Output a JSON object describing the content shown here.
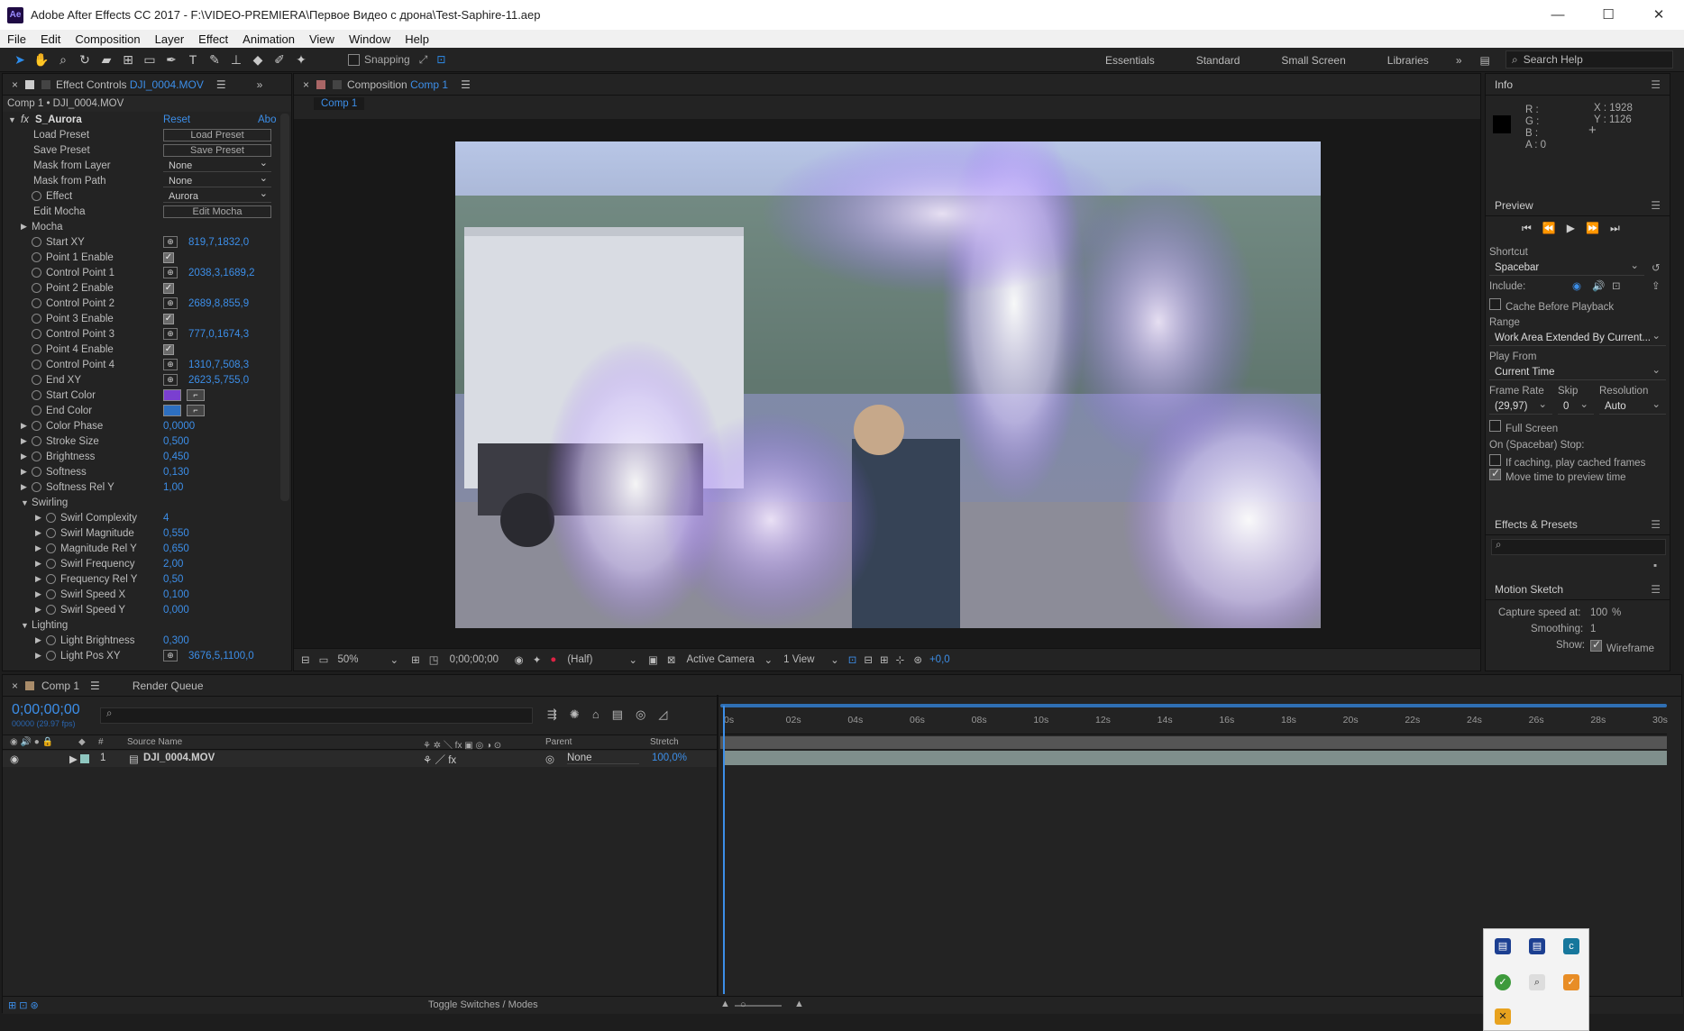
{
  "window": {
    "title": "Adobe After Effects CC 2017 - F:\\VIDEO-PREMIERA\\Первое Видео с дрона\\Test-Saphire-11.aep",
    "logo": "Ae"
  },
  "menu": [
    "File",
    "Edit",
    "Composition",
    "Layer",
    "Effect",
    "Animation",
    "View",
    "Window",
    "Help"
  ],
  "toolbar": {
    "snapping": "Snapping",
    "workspaces": [
      "Essentials",
      "Standard",
      "Small Screen",
      "Libraries"
    ],
    "search_placeholder": "Search Help"
  },
  "effect_controls": {
    "tab_label": "Effect Controls",
    "tab_file": "DJI_0004.MOV",
    "breadcrumb": "Comp 1 • DJI_0004.MOV",
    "effect_name": "S_Aurora",
    "reset": "Reset",
    "about": "Abo",
    "rows": [
      {
        "label": "Load Preset",
        "kind": "button",
        "value": "Load Preset"
      },
      {
        "label": "Save Preset",
        "kind": "button",
        "value": "Save Preset"
      },
      {
        "label": "Mask from Layer",
        "kind": "dropdown",
        "value": "None"
      },
      {
        "label": "Mask from Path",
        "kind": "dropdown",
        "value": "None"
      },
      {
        "label": "Effect",
        "kind": "dropdown",
        "value": "Aurora",
        "sw": true
      },
      {
        "label": "Edit Mocha",
        "kind": "button",
        "value": "Edit Mocha"
      },
      {
        "label": "Mocha",
        "kind": "group",
        "indent": 0
      },
      {
        "label": "Start XY",
        "kind": "xy",
        "value": "819,7,1832,0",
        "sw": true
      },
      {
        "label": "Point 1 Enable",
        "kind": "check",
        "sw": true
      },
      {
        "label": "Control Point 1",
        "kind": "xy",
        "value": "2038,3,1689,2",
        "sw": true
      },
      {
        "label": "Point 2 Enable",
        "kind": "check",
        "sw": true
      },
      {
        "label": "Control Point 2",
        "kind": "xy",
        "value": "2689,8,855,9",
        "sw": true
      },
      {
        "label": "Point 3 Enable",
        "kind": "check",
        "sw": true
      },
      {
        "label": "Control Point 3",
        "kind": "xy",
        "value": "777,0,1674,3",
        "sw": true
      },
      {
        "label": "Point 4 Enable",
        "kind": "check",
        "sw": true
      },
      {
        "label": "Control Point 4",
        "kind": "xy",
        "value": "1310,7,508,3",
        "sw": true
      },
      {
        "label": "End XY",
        "kind": "xy",
        "value": "2623,5,755,0",
        "sw": true
      },
      {
        "label": "Start Color",
        "kind": "color",
        "color": "#7a3fd0",
        "sw": true
      },
      {
        "label": "End Color",
        "kind": "color",
        "color": "#2d6fc0",
        "sw": true
      },
      {
        "label": "Color Phase",
        "kind": "num",
        "value": "0,0000",
        "sw": true,
        "exp": true
      },
      {
        "label": "Stroke Size",
        "kind": "num",
        "value": "0,500",
        "sw": true,
        "exp": true
      },
      {
        "label": "Brightness",
        "kind": "num",
        "value": "0,450",
        "sw": true,
        "exp": true
      },
      {
        "label": "Softness",
        "kind": "num",
        "value": "0,130",
        "sw": true,
        "exp": true
      },
      {
        "label": "Softness Rel Y",
        "kind": "num",
        "value": "1,00",
        "sw": true,
        "exp": true
      },
      {
        "label": "Swirling",
        "kind": "group-open",
        "indent": 0
      },
      {
        "label": "Swirl Complexity",
        "kind": "num",
        "value": "4",
        "sw": true,
        "exp": true,
        "indent": 1
      },
      {
        "label": "Swirl Magnitude",
        "kind": "num",
        "value": "0,550",
        "sw": true,
        "exp": true,
        "indent": 1
      },
      {
        "label": "Magnitude Rel Y",
        "kind": "num",
        "value": "0,650",
        "sw": true,
        "exp": true,
        "indent": 1
      },
      {
        "label": "Swirl Frequency",
        "kind": "num",
        "value": "2,00",
        "sw": true,
        "exp": true,
        "indent": 1
      },
      {
        "label": "Frequency Rel Y",
        "kind": "num",
        "value": "0,50",
        "sw": true,
        "exp": true,
        "indent": 1
      },
      {
        "label": "Swirl Speed X",
        "kind": "num",
        "value": "0,100",
        "sw": true,
        "exp": true,
        "indent": 1
      },
      {
        "label": "Swirl Speed Y",
        "kind": "num",
        "value": "0,000",
        "sw": true,
        "exp": true,
        "indent": 1
      },
      {
        "label": "Lighting",
        "kind": "group-open",
        "indent": 0
      },
      {
        "label": "Light Brightness",
        "kind": "num",
        "value": "0,300",
        "sw": true,
        "exp": true,
        "indent": 1
      },
      {
        "label": "Light Pos XY",
        "kind": "xy",
        "value": "3676,5,1100,0",
        "sw": true,
        "exp": true,
        "indent": 1
      }
    ]
  },
  "composition": {
    "tab_label": "Composition",
    "tab_comp": "Comp 1",
    "sub_tab": "Comp 1",
    "bottom": {
      "zoom": "50%",
      "timecode": "0;00;00;00",
      "resolution": "(Half)",
      "camera": "Active Camera",
      "views": "1 View",
      "exposure": "+0,0"
    }
  },
  "info": {
    "title": "Info",
    "r": "R :",
    "g": "G :",
    "b": "B :",
    "a": "A : 0",
    "x": "X : 1928",
    "y": "Y : 1126"
  },
  "preview": {
    "title": "Preview",
    "shortcut_label": "Shortcut",
    "shortcut": "Spacebar",
    "include": "Include:",
    "cache": "Cache Before Playback",
    "range_label": "Range",
    "range": "Work Area Extended By Current...",
    "play_from_label": "Play From",
    "play_from": "Current Time",
    "frame_rate_label": "Frame Rate",
    "skip_label": "Skip",
    "resolution_label": "Resolution",
    "frame_rate": "(29,97)",
    "skip": "0",
    "resolution": "Auto",
    "full_screen": "Full Screen",
    "on_stop": "On (Spacebar) Stop:",
    "if_caching": "If caching, play cached frames",
    "move_time": "Move time to preview time"
  },
  "effects_presets": {
    "title": "Effects & Presets"
  },
  "motion_sketch": {
    "title": "Motion Sketch",
    "capture_label": "Capture speed at:",
    "capture_value": "100",
    "capture_unit": "%",
    "smoothing_label": "Smoothing:",
    "smoothing_value": "1",
    "show_label": "Show:",
    "wireframe": "Wireframe"
  },
  "timeline": {
    "tab": "Comp 1",
    "render_queue": "Render Queue",
    "timecode": "0;00;00;00",
    "fps": "00000 (29.97 fps)",
    "col_source": "Source Name",
    "col_parent": "Parent",
    "col_stretch": "Stretch",
    "layer": {
      "num": "1",
      "name": "DJI_0004.MOV",
      "parent": "None",
      "stretch": "100,0%"
    },
    "ruler": [
      "0s",
      "02s",
      "04s",
      "06s",
      "08s",
      "10s",
      "12s",
      "14s",
      "16s",
      "18s",
      "20s",
      "22s",
      "24s",
      "26s",
      "28s",
      "30s"
    ],
    "toggle": "Toggle Switches / Modes"
  },
  "colors": {
    "accent": "#3c8ee8",
    "panel": "#232323",
    "bg": "#1d1d1d"
  }
}
